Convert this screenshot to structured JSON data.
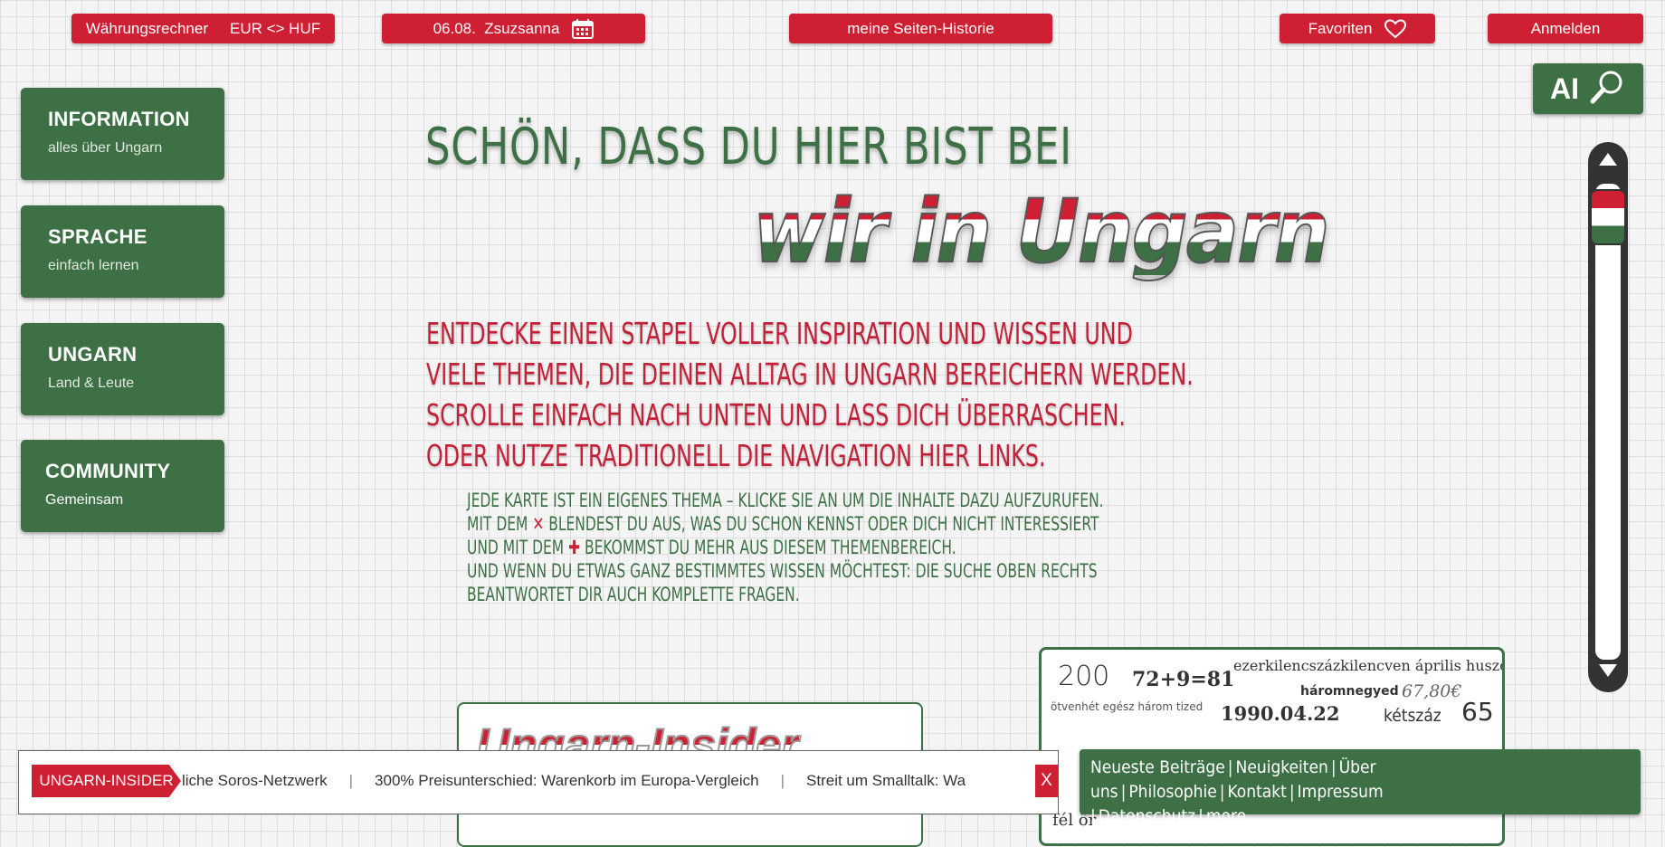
{
  "topbar": {
    "currency_label": "Währungsrechner",
    "currency_pair": "EUR <> HUF",
    "date_label": "06.08.  Zsuzsanna",
    "history_label": "meine Seiten-Historie",
    "favorites_label": "Favoriten",
    "login_label": "Anmelden"
  },
  "nav": [
    {
      "title": "INFORMATION",
      "subtitle": "alles über Ungarn"
    },
    {
      "title": "SPRACHE",
      "subtitle": "einfach lernen"
    },
    {
      "title": "UNGARN",
      "subtitle": "Land & Leute"
    },
    {
      "title": "COMMUNITY",
      "subtitle": "Gemeinsam"
    }
  ],
  "ai_search": {
    "label": "AI"
  },
  "hero": {
    "title": "SCHÖN, DASS DU HIER BIST BEI",
    "brand": "wir in Ungarn",
    "intro": [
      "ENTDECKE EINEN STAPEL VOLLER INSPIRATION UND WISSEN UND",
      "VIELE THEMEN, DIE DEINEN ALLTAG IN UNGARN BEREICHERN WERDEN.",
      "SCROLLE EINFACH NACH UNTEN UND LASS DICH ÜBERRASCHEN.",
      "ODER NUTZE TRADITIONELL DIE NAVIGATION HIER LINKS."
    ],
    "hint_line1": "JEDE KARTE IST EIN EIGENES THEMA – KLICKE SIE AN UM DIE INHALTE DAZU AUFZURUFEN.",
    "hint_line2_pre": "MIT DEM",
    "hint_line2_post": "BLENDEST DU AUS, WAS DU SCHON KENNST ODER DICH NICHT INTERESSIERT",
    "hint_line3_pre": "UND MIT DEM",
    "hint_line3_post": "BEKOMMST DU MEHR AUS DIESEM THEMENBEREICH.",
    "hint_line4": "UND WENN DU ETWAS GANZ BESTIMMTES WISSEN MÖCHTEST: DIE SUCHE OBEN RECHTS",
    "hint_line5": "BEANTWORTET DIR AUCH KOMPLETTE FRAGEN.",
    "icon_x": "✕",
    "icon_plus": "✚"
  },
  "card_insider": {
    "logo": "Ungarn-Insider"
  },
  "card_numbers": {
    "n1": "200",
    "n2": "72+9=81",
    "n3": "ezerkilencszázkilencven április huszonkettedike",
    "n4": "háromnegyed",
    "n5": "67,80€",
    "n6": "ötvenhét egész három tized",
    "n7": "1990.04.22",
    "n8": "kétszáz",
    "n9": "65",
    "n10": "fél ör"
  },
  "ticker": {
    "label": "UNGARN-INSIDER",
    "items": [
      "liche Soros-Netzwerk",
      "300% Preisunterschied: Warenkorb im Europa-Vergleich",
      "Streit um Smalltalk: Wa"
    ],
    "close": "X"
  },
  "footer": {
    "links": [
      "Neueste Beiträge",
      "Neuigkeiten",
      "Über uns",
      "Philosophie",
      "Kontakt",
      "Impressum",
      "Datenschutz",
      "more"
    ],
    "separator": "|"
  },
  "colors": {
    "red": "#cf1f32",
    "green": "#3e7046"
  }
}
